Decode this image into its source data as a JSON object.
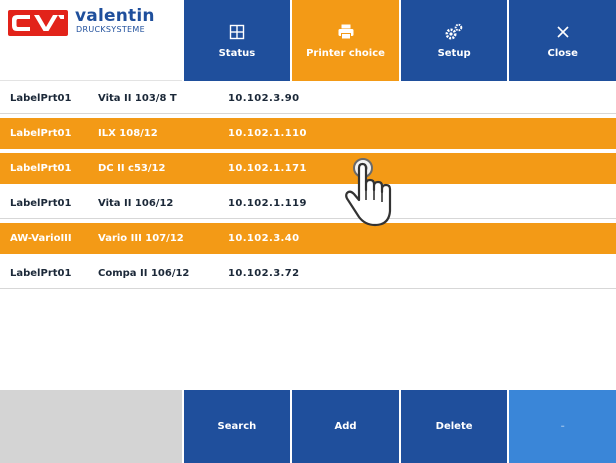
{
  "brand": {
    "name": "valentin",
    "subtitle": "DRUCKSYSTEME",
    "logo_icon": "cv-logo"
  },
  "header": {
    "buttons": [
      {
        "label": "Status",
        "icon": "book-icon",
        "active": false
      },
      {
        "label": "Printer choice",
        "icon": "printer-icon",
        "active": true
      },
      {
        "label": "Setup",
        "icon": "gears-icon",
        "active": false
      },
      {
        "label": "Close",
        "icon": "close-icon",
        "active": false
      }
    ]
  },
  "printers": [
    {
      "name": "LabelPrt01",
      "model": "Vita II 103/8 T",
      "ip": "10.102.3.90",
      "selected": false
    },
    {
      "name": "LabelPrt01",
      "model": "ILX 108/12",
      "ip": "10.102.1.110",
      "selected": true
    },
    {
      "name": "LabelPrt01",
      "model": "DC II c53/12",
      "ip": "10.102.1.171",
      "selected": true
    },
    {
      "name": "LabelPrt01",
      "model": "Vita II 106/12",
      "ip": "10.102.1.119",
      "selected": false
    },
    {
      "name": "AW-VarioIII",
      "model": "Vario III 107/12",
      "ip": "10.102.3.40",
      "selected": true
    },
    {
      "name": "LabelPrt01",
      "model": "Compa II 106/12",
      "ip": "10.102.3.72",
      "selected": false
    }
  ],
  "footer": {
    "buttons": [
      {
        "label": "Search"
      },
      {
        "label": "Add"
      },
      {
        "label": "Delete"
      },
      {
        "label": "-"
      }
    ]
  },
  "cursor": {
    "icon": "hand-pointer-icon"
  },
  "colors": {
    "primary": "#1f4f9c",
    "accent": "#f39a16",
    "logo_red": "#e2231a",
    "footer_gray": "#d4d4d4",
    "light_blue": "#3a86d8"
  }
}
